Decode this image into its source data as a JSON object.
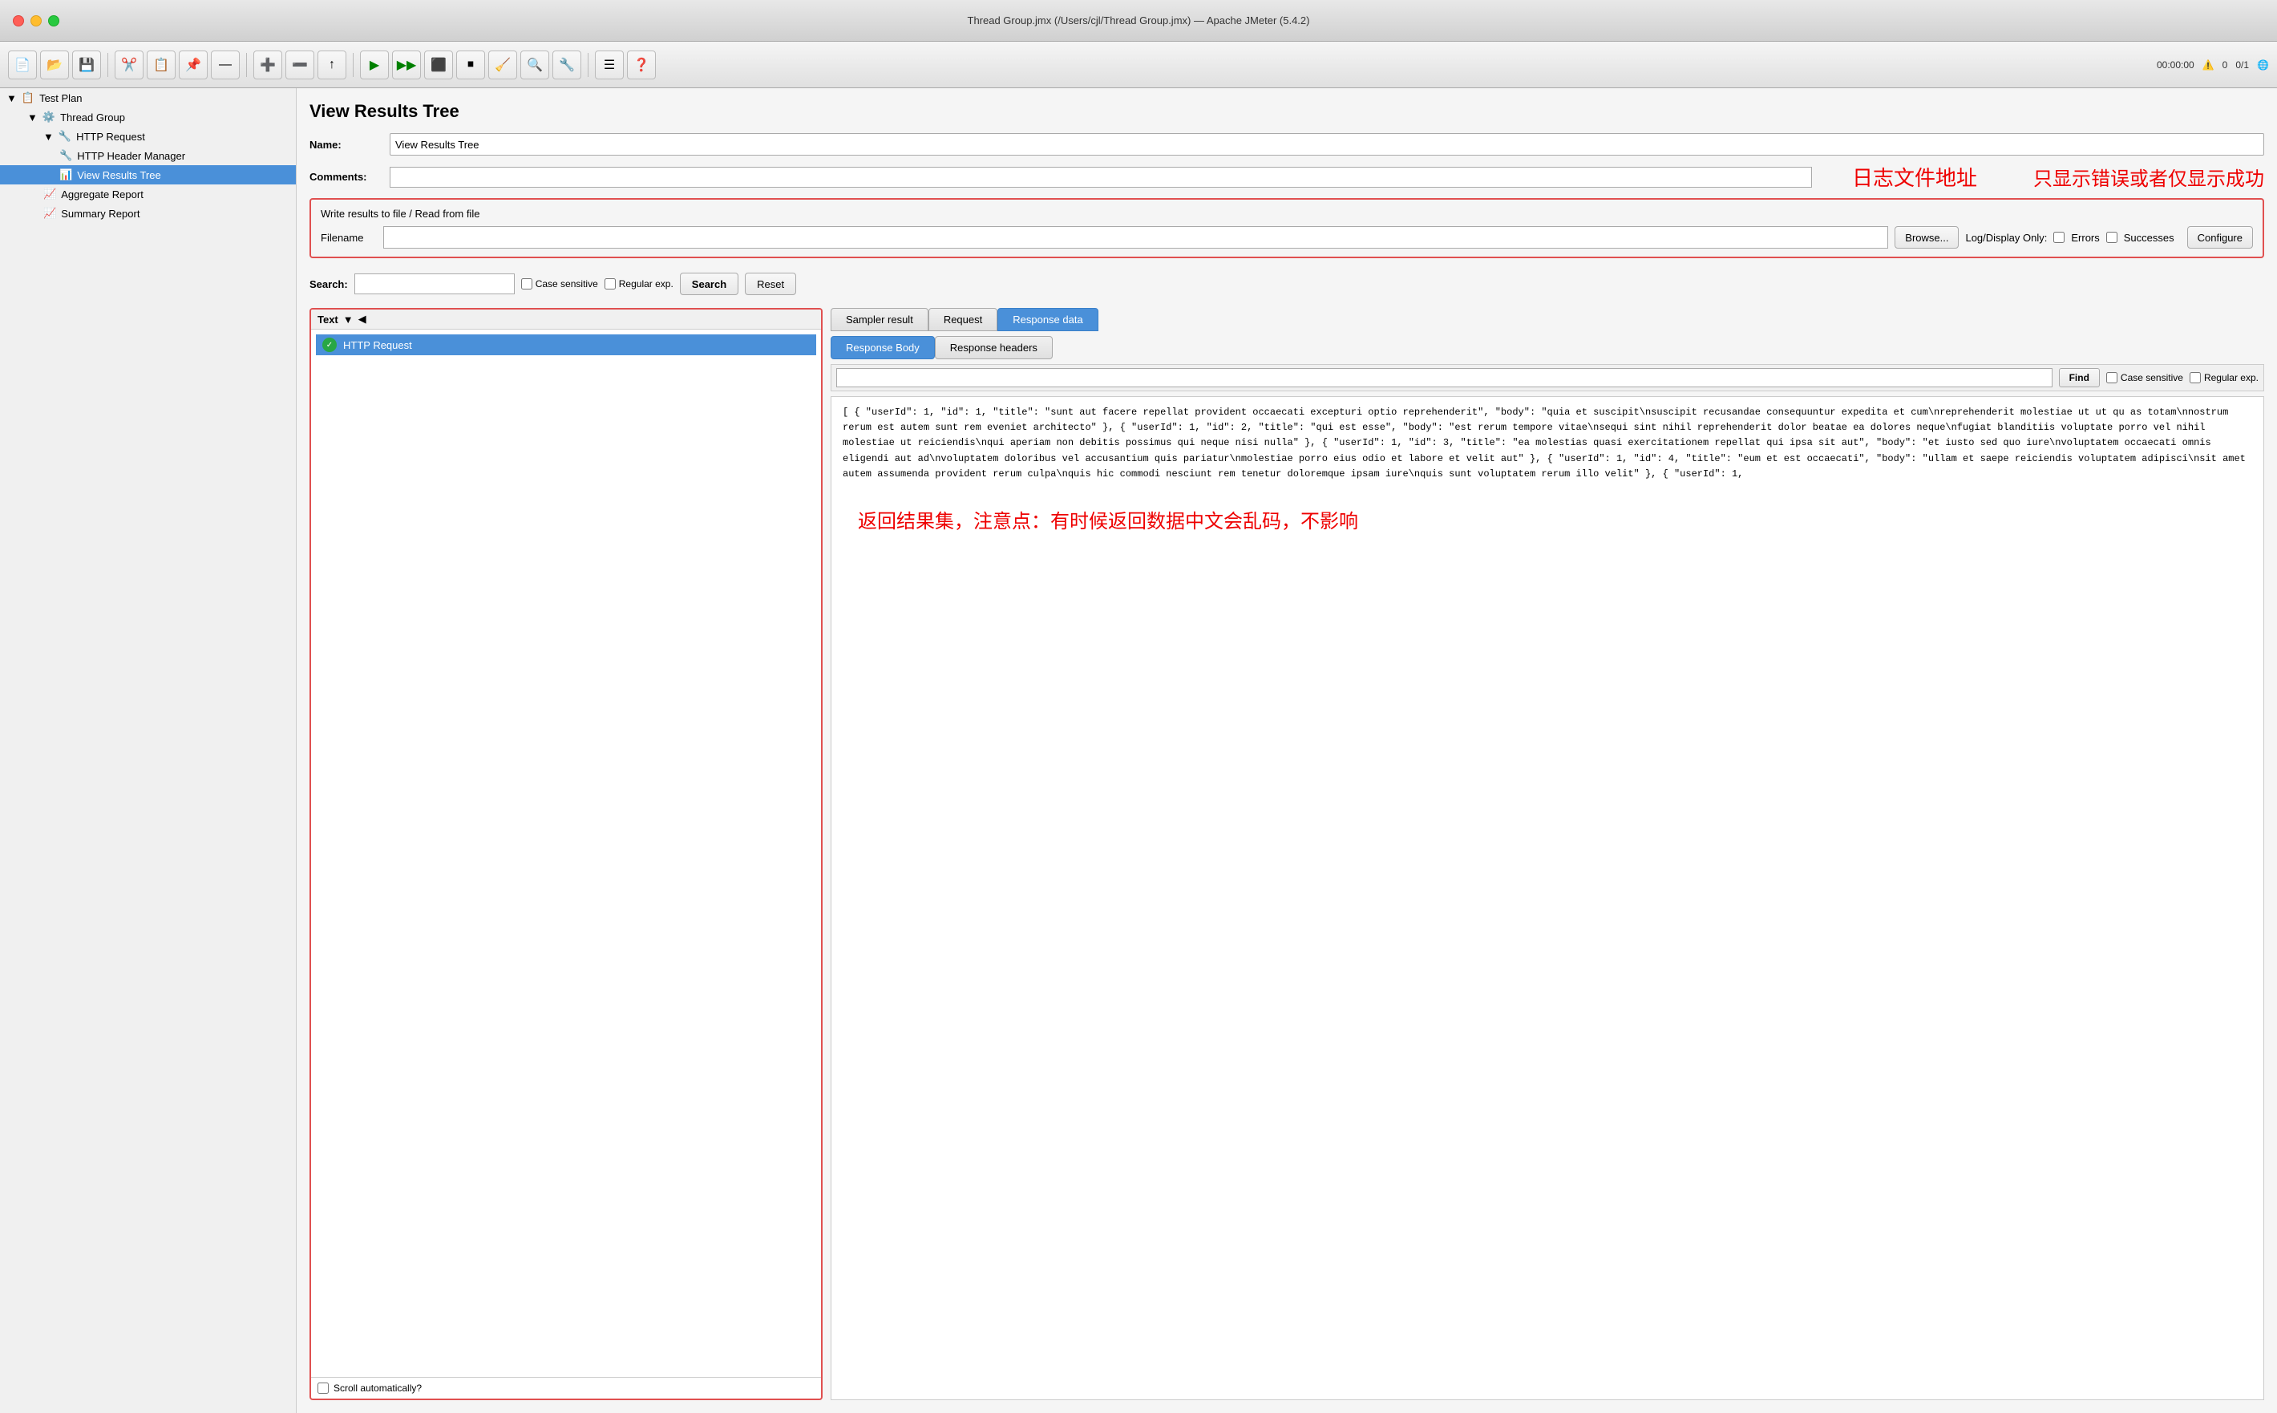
{
  "window": {
    "title": "Thread Group.jmx (/Users/cjl/Thread Group.jmx) — Apache JMeter (5.4.2)"
  },
  "toolbar": {
    "time": "00:00:00",
    "warnings": "0",
    "threads": "0/1"
  },
  "sidebar": {
    "items": [
      {
        "id": "test-plan",
        "label": "Test Plan",
        "level": 0,
        "icon": "📋",
        "selected": false
      },
      {
        "id": "thread-group",
        "label": "Thread Group",
        "level": 1,
        "icon": "⚙️",
        "selected": false
      },
      {
        "id": "http-request",
        "label": "HTTP Request",
        "level": 2,
        "icon": "🔧",
        "selected": false
      },
      {
        "id": "http-header-manager",
        "label": "HTTP Header Manager",
        "level": 3,
        "icon": "🔧",
        "selected": false
      },
      {
        "id": "view-results-tree",
        "label": "View Results Tree",
        "level": 3,
        "icon": "📊",
        "selected": true
      },
      {
        "id": "aggregate-report",
        "label": "Aggregate Report",
        "level": 2,
        "icon": "📈",
        "selected": false
      },
      {
        "id": "summary-report",
        "label": "Summary Report",
        "level": 2,
        "icon": "📈",
        "selected": false
      }
    ]
  },
  "panel": {
    "title": "View Results Tree",
    "name_label": "Name:",
    "name_value": "View Results Tree",
    "comments_label": "Comments:",
    "comments_value": "",
    "file_section_title": "Write results to file / Read from file",
    "filename_label": "Filename",
    "filename_value": "",
    "browse_label": "Browse...",
    "log_display_label": "Log/Display Only:",
    "errors_label": "Errors",
    "successes_label": "Successes",
    "configure_label": "Configure",
    "annotation_log": "日志文件地址",
    "annotation_display": "只显示错误或者仅显示成功",
    "annotation_result": "返回结果集，注意点：有时候返回数据中文会乱码，不影响"
  },
  "search_bar": {
    "label": "Search:",
    "placeholder": "",
    "case_sensitive_label": "Case sensitive",
    "regular_exp_label": "Regular exp.",
    "search_btn": "Search",
    "reset_btn": "Reset"
  },
  "left_pane": {
    "dropdown_label": "Text",
    "request_item": "HTTP Request",
    "scroll_label": "Scroll automatically?"
  },
  "right_pane": {
    "tabs_top": [
      "Sampler result",
      "Request",
      "Response data"
    ],
    "tabs_second": [
      "Response Body",
      "Response headers"
    ],
    "active_top": "Response data",
    "active_second": "Response Body",
    "find_label": "Find",
    "case_sensitive_label": "Case sensitive",
    "regular_exp_label": "Regular exp."
  },
  "response_content": [
    "[",
    "  {",
    "    \"userId\": 1,",
    "    \"id\": 1,",
    "    \"title\": \"sunt aut facere repellat provident occaecati excepturi optio reprehenderit\",",
    "    \"body\": \"quia et suscipit\\nsuscipit recusandae consequuntur expedita et cum\\nreprehenderit molestiae ut ut qu",
    "as totam\\nnostrum rerum est autem sunt rem eveniet architecto\"",
    "  },",
    "  {",
    "    \"userId\": 1,",
    "    \"id\": 2,",
    "    \"title\": \"qui est esse\",",
    "    \"body\": \"est rerum tempore vitae\\nsequi sint nihil reprehenderit dolor beatae ea dolores neque\\nfugiat blanditiis voluptate porro vel nihil molestiae ut reiciendis\\nqui aperiam non debitis possimus qui neque nisi nulla\"",
    "  },",
    "  {",
    "    \"userId\": 1,",
    "    \"id\": 3,",
    "    \"title\": \"ea molestias quasi exercitationem repellat qui ipsa sit aut\",",
    "    \"body\": \"et iusto sed quo iure\\nvoluptatem occaecati omnis eligendi aut ad\\nvoluptatem doloribus vel accusantium quis pariatur\\nmolestiae porro eius odio et labore et velit aut\"",
    "  },",
    "  {",
    "    \"userId\": 1,",
    "    \"id\": 4,",
    "    \"title\": \"eum et est occaecati\",",
    "    \"body\": \"ullam et saepe reiciendis voluptatem adipisci\\nsit amet autem assumenda provident rerum culpa\\nquis hic commodi nesciunt rem tenetur doloremque ipsam iure\\nquis sunt voluptatem rerum illo velit\"",
    "  },",
    "  {",
    "    \"userId\": 1,"
  ]
}
